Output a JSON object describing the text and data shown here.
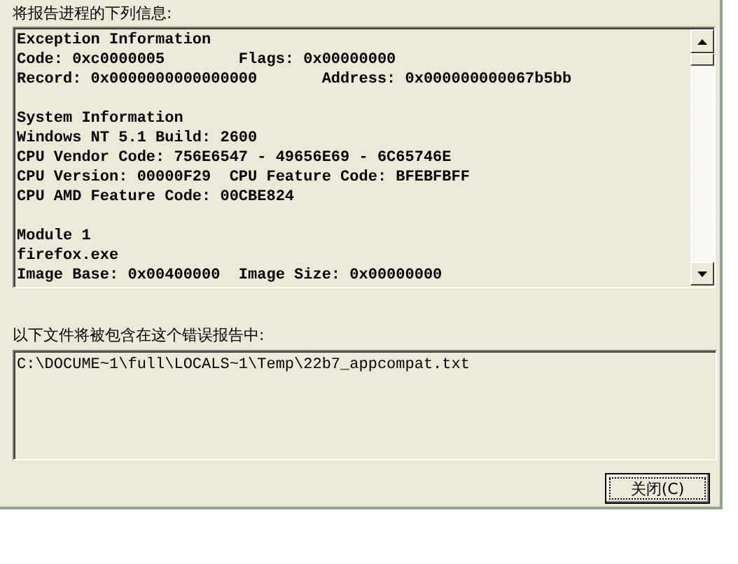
{
  "report_label": "将报告进程的下列信息:",
  "report_sections": [
    {
      "lines": [
        "Exception Information",
        "Code: 0xc0000005        Flags: 0x00000000",
        "Record: 0x0000000000000000       Address: 0x000000000067b5bb"
      ]
    },
    {
      "lines": [
        "System Information",
        "Windows NT 5.1 Build: 2600",
        "CPU Vendor Code: 756E6547 - 49656E69 - 6C65746E",
        "CPU Version: 00000F29  CPU Feature Code: BFEBFBFF",
        "CPU AMD Feature Code: 00CBE824"
      ]
    },
    {
      "lines": [
        "Module 1",
        "firefox.exe",
        "Image Base: 0x00400000  Image Size: 0x00000000"
      ]
    }
  ],
  "files_label": "以下文件将被包含在这个错误报告中:",
  "files": [
    "C:\\DOCUME~1\\full\\LOCALS~1\\Temp\\22b7_appcompat.txt"
  ],
  "close_button": "关闭(C)"
}
